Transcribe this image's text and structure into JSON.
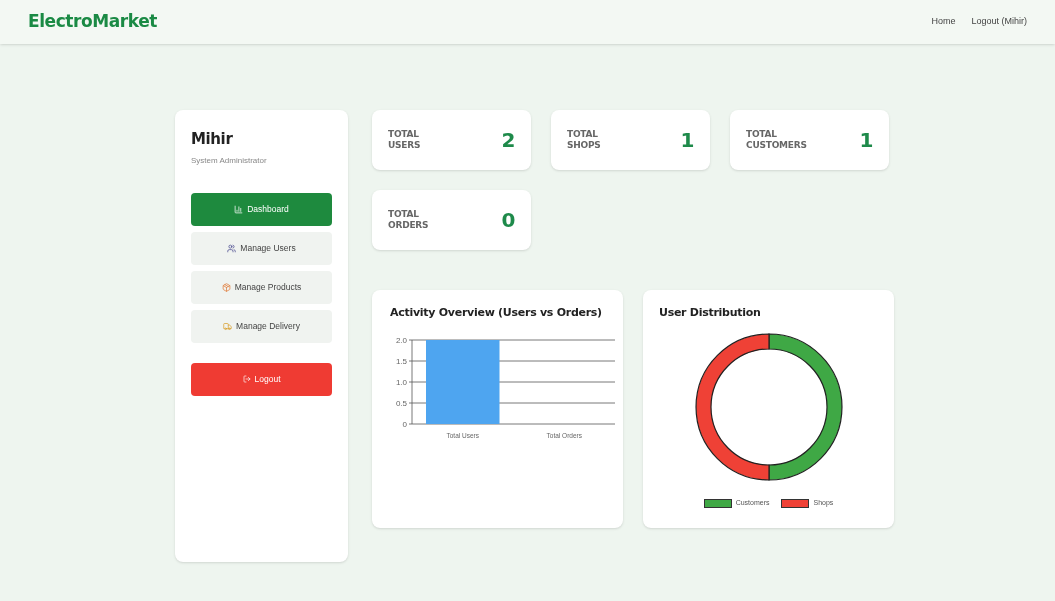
{
  "header": {
    "brand": "ElectroMarket",
    "links": [
      "Home",
      "Logout (Mihir)"
    ]
  },
  "profile": {
    "name": "Mihir",
    "role": "System Administrator"
  },
  "sidebar": {
    "items": [
      {
        "label": "Dashboard",
        "kind": "dashboard",
        "selected": true
      },
      {
        "label": "Manage Users",
        "kind": "users",
        "selected": false
      },
      {
        "label": "Manage Products",
        "kind": "products",
        "selected": false
      },
      {
        "label": "Manage Delivery",
        "kind": "delivery",
        "selected": false
      }
    ],
    "logout": "Logout"
  },
  "stats": [
    {
      "label": "TOTAL USERS",
      "value": "2"
    },
    {
      "label": "TOTAL SHOPS",
      "value": "1"
    },
    {
      "label": "TOTAL CUSTOMERS",
      "value": "1"
    },
    {
      "label": "TOTAL ORDERS",
      "value": "0"
    }
  ],
  "activity": {
    "title": "Activity Overview (Users vs Orders)",
    "chart_data": {
      "type": "bar",
      "categories": [
        "Total Users",
        "Total Orders"
      ],
      "series": [
        {
          "color": "#4ea5f0",
          "values": [
            2,
            0
          ]
        }
      ],
      "grid": true,
      "ylim": [
        0,
        2
      ],
      "yticks": [
        {
          "value": 0,
          "label": "0"
        },
        {
          "value": 0.5,
          "label": "0.5"
        },
        {
          "value": 1,
          "label": "1.0"
        },
        {
          "value": 1.5,
          "label": "1.5"
        },
        {
          "value": 2,
          "label": "2.0"
        }
      ]
    }
  },
  "distribution": {
    "title": "User Distribution",
    "chart_data": {
      "type": "donut",
      "categories": [
        "Customers",
        "Shops"
      ],
      "series": [
        {
          "values": [
            50,
            50
          ]
        }
      ],
      "colors": [
        "#3fa845",
        "#ef4136"
      ]
    }
  }
}
